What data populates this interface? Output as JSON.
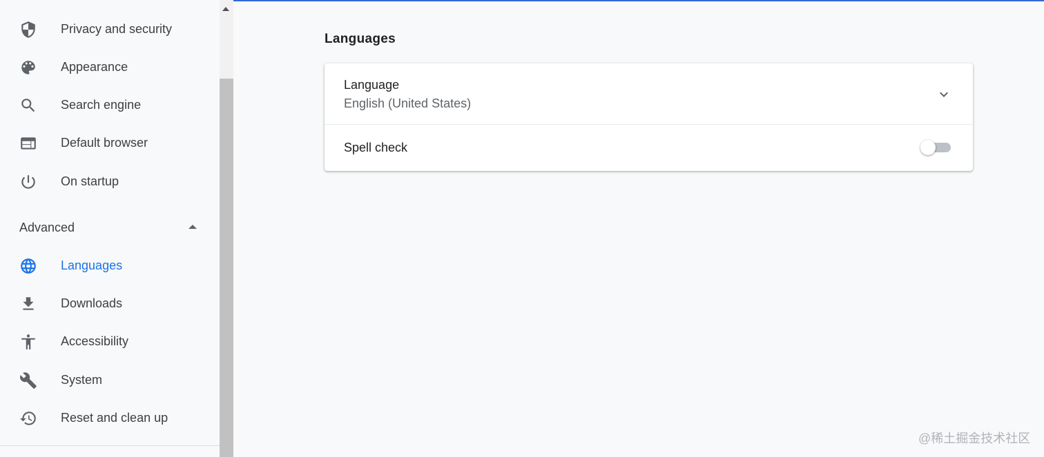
{
  "colors": {
    "accent": "#1a73e8",
    "top_bar": "#3367d6",
    "icon": "#5f6368",
    "text": "#3c4043",
    "background": "#f8f9fa"
  },
  "sidebar": {
    "items": [
      {
        "label": "Privacy and security",
        "icon": "shield-icon"
      },
      {
        "label": "Appearance",
        "icon": "palette-icon"
      },
      {
        "label": "Search engine",
        "icon": "search-icon"
      },
      {
        "label": "Default browser",
        "icon": "browser-window-icon"
      },
      {
        "label": "On startup",
        "icon": "power-icon"
      }
    ],
    "advanced_label": "Advanced",
    "advanced_items": [
      {
        "label": "Languages",
        "icon": "globe-icon",
        "active": true
      },
      {
        "label": "Downloads",
        "icon": "download-icon"
      },
      {
        "label": "Accessibility",
        "icon": "accessibility-icon"
      },
      {
        "label": "System",
        "icon": "wrench-icon"
      },
      {
        "label": "Reset and clean up",
        "icon": "restore-icon"
      }
    ]
  },
  "main": {
    "section_title": "Languages",
    "language": {
      "title": "Language",
      "value": "English (United States)"
    },
    "spell_check": {
      "label": "Spell check",
      "enabled": false
    }
  },
  "watermark": "@稀土掘金技术社区"
}
